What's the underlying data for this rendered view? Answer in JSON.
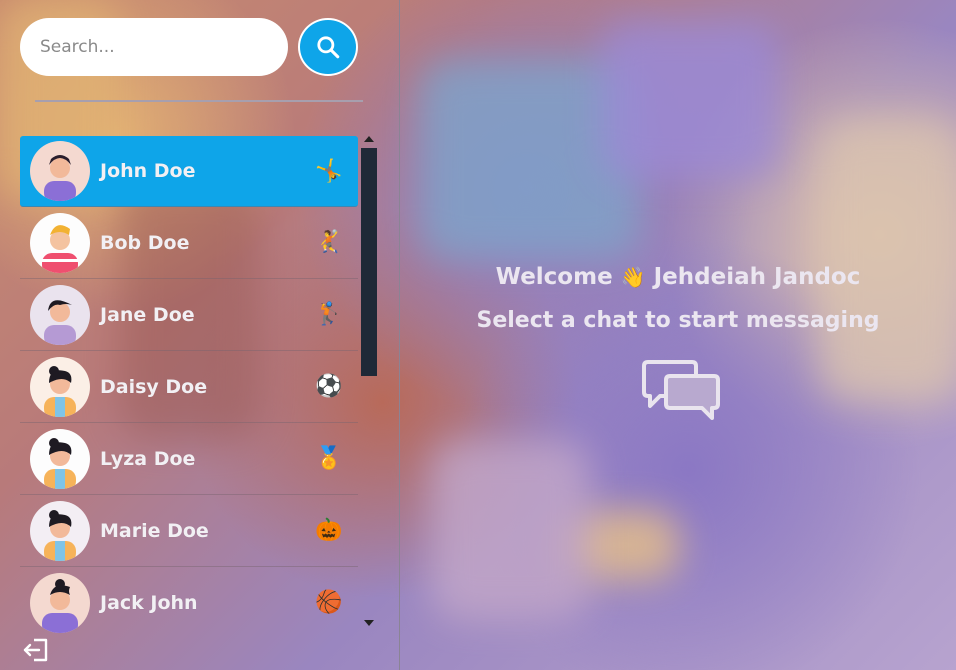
{
  "search": {
    "placeholder": "Search..."
  },
  "contacts": [
    {
      "name": "John Doe",
      "emoji": "🤸",
      "active": true
    },
    {
      "name": "Bob Doe",
      "emoji": "🤾",
      "active": false
    },
    {
      "name": "Jane Doe",
      "emoji": "🏌",
      "active": false
    },
    {
      "name": "Daisy Doe",
      "emoji": "⚽",
      "active": false
    },
    {
      "name": "Lyza Doe",
      "emoji": "🏅",
      "active": false
    },
    {
      "name": "Marie Doe",
      "emoji": "🎃",
      "active": false
    },
    {
      "name": "Jack John",
      "emoji": "🏀",
      "active": false
    }
  ],
  "welcome": {
    "greeting": "Welcome",
    "wave": "👋",
    "user_name": "Jehdeiah Jandoc",
    "subtitle": "Select a chat to start messaging"
  },
  "colors": {
    "accent": "#0ea5e9",
    "thumb": "#1f2937"
  }
}
